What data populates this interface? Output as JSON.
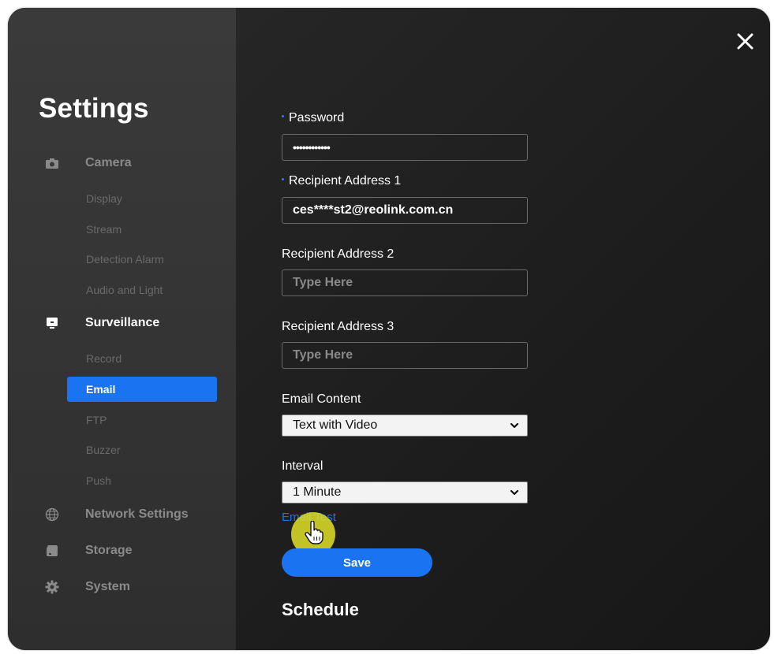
{
  "settings_title": "Settings",
  "sidebar": {
    "sections": [
      {
        "key": "camera",
        "label": "Camera",
        "icon": "camera-icon",
        "items": [
          "Display",
          "Stream",
          "Detection Alarm",
          "Audio and Light"
        ]
      },
      {
        "key": "surveillance",
        "label": "Surveillance",
        "icon": "monitor-icon",
        "items": [
          "Record",
          "Email",
          "FTP",
          "Buzzer",
          "Push"
        ]
      },
      {
        "key": "network",
        "label": "Network Settings",
        "icon": "globe-icon",
        "items": []
      },
      {
        "key": "storage",
        "label": "Storage",
        "icon": "storage-icon",
        "items": []
      },
      {
        "key": "system",
        "label": "System",
        "icon": "gear-icon",
        "items": []
      }
    ],
    "selected_item": "Email",
    "active_section": "Surveillance"
  },
  "form": {
    "password": {
      "label": "Password",
      "value": "••••••••••••",
      "required": true
    },
    "recipient1": {
      "label": "Recipient Address 1",
      "value": "ces****st2@reolink.com.cn",
      "required": true
    },
    "recipient2": {
      "label": "Recipient Address 2",
      "value": "",
      "placeholder": "Type Here"
    },
    "recipient3": {
      "label": "Recipient Address 3",
      "value": "",
      "placeholder": "Type Here"
    },
    "email_content": {
      "label": "Email Content",
      "value": "Text with Video"
    },
    "interval": {
      "label": "Interval",
      "value": "1 Minute"
    },
    "email_test_label": "Email Test",
    "save_label": "Save"
  },
  "schedule_heading": "Schedule",
  "colors": {
    "accent": "#1a73f0",
    "required_dot": "#2b7fff",
    "cursor_highlight": "#e2e028"
  }
}
